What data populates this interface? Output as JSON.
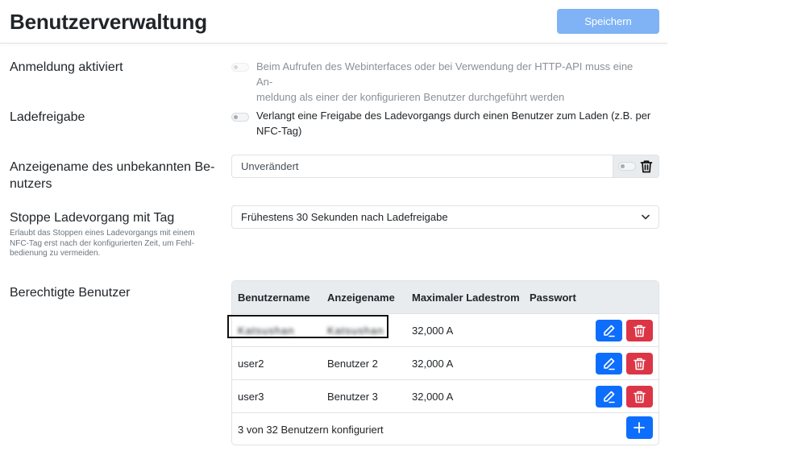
{
  "header": {
    "title": "Benutzerverwaltung",
    "save_label": "Speichern"
  },
  "settings": {
    "login": {
      "label": "Anmeldung aktiviert",
      "description_line1": "Beim Aufrufen des Webinterfaces oder bei Verwendung der HTTP-API muss eine An-",
      "description_line2": "meldung als einer der konfigurieren Benutzer durchgeführt werden",
      "enabled": false,
      "disabled": true
    },
    "charge_release": {
      "label": "Ladefreigabe",
      "description_line1": "Verlangt eine Freigabe des Ladevorgangs durch einen Benutzer zum Laden (z.B. per",
      "description_line2": "NFC-Tag)",
      "enabled": false
    },
    "unknown_user_name": {
      "label_line1": "Anzeigename des unbekannten Be-",
      "label_line2": "nutzers",
      "value": "Unverändert",
      "toggle_enabled": false
    },
    "stop_with_tag": {
      "label": "Stoppe Ladevorgang mit Tag",
      "help_line1": "Erlaubt das Stoppen eines Ladevorgangs mit einem",
      "help_line2": "NFC-Tag erst nach der konfigurierten Zeit, um Fehl-",
      "help_line3": "bedienung zu vermeiden.",
      "selected": "Frühestens 30 Sekunden nach Ladefreigabe"
    }
  },
  "users": {
    "label": "Berechtigte Benutzer",
    "columns": [
      "Benutzername",
      "Anzeigename",
      "Maximaler Ladestrom",
      "Passwort"
    ],
    "rows": [
      {
        "username": "Katsushan",
        "display_name": "Katsushan",
        "max_current": "32,000 A",
        "redacted": true
      },
      {
        "username": "user2",
        "display_name": "Benutzer 2",
        "max_current": "32,000 A",
        "redacted": false
      },
      {
        "username": "user3",
        "display_name": "Benutzer 3",
        "max_current": "32,000 A",
        "redacted": false
      }
    ],
    "footer": "3 von 32 Benutzern konfiguriert"
  },
  "colors": {
    "primary": "#0d6efd",
    "primary_disabled": "#7fb3f5",
    "danger": "#dc3545",
    "table_header": "#e9ecef"
  },
  "icons": {
    "edit": "pencil-icon",
    "delete": "trash-icon",
    "add": "plus-icon",
    "dropdown": "chevron-down-icon"
  }
}
